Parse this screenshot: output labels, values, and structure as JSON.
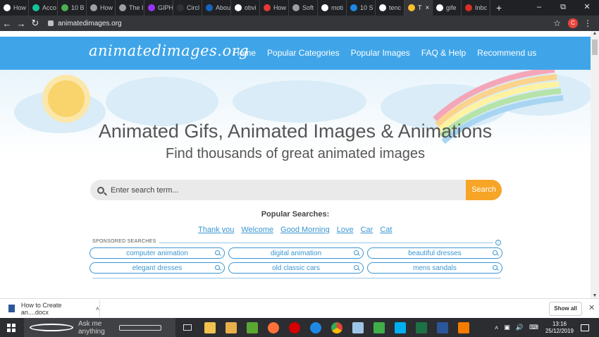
{
  "browser": {
    "tabs": [
      {
        "label": "How",
        "icon": "wikipedia-icon",
        "color": "#ffffff"
      },
      {
        "label": "Acco",
        "icon": "grammarly-icon",
        "color": "#15c39a"
      },
      {
        "label": "10 B",
        "icon": "feather-icon",
        "color": "#4caf50"
      },
      {
        "label": "How",
        "icon": "globe-icon",
        "color": "#9aa0a6"
      },
      {
        "label": "The I",
        "icon": "globe-icon",
        "color": "#9aa0a6"
      },
      {
        "label": "GIPH",
        "icon": "giphy-icon",
        "color": "#9933ff"
      },
      {
        "label": "Circl",
        "icon": "dark-icon",
        "color": "#333333"
      },
      {
        "label": "Abou",
        "icon": "gif-icon",
        "color": "#1565c0"
      },
      {
        "label": "obvi",
        "icon": "google-icon",
        "color": "#ffffff"
      },
      {
        "label": "How",
        "icon": "bookmark-icon",
        "color": "#e53935"
      },
      {
        "label": "Soft",
        "icon": "globe-icon",
        "color": "#9aa0a6"
      },
      {
        "label": "moti",
        "icon": "google-icon",
        "color": "#ffffff"
      },
      {
        "label": "10 S",
        "icon": "h-icon",
        "color": "#1e88e5"
      },
      {
        "label": "tenc",
        "icon": "google-icon",
        "color": "#ffffff"
      },
      {
        "label": "T",
        "icon": "star-icon",
        "color": "#fbc02d",
        "active": true
      },
      {
        "label": "gife",
        "icon": "google-icon",
        "color": "#ffffff"
      },
      {
        "label": "Inbc",
        "icon": "gmail-icon",
        "color": "#d93025"
      }
    ],
    "new_tab": "+",
    "url": "animatedimages.org",
    "profile_initial": "C"
  },
  "site": {
    "logo": "animatedimages.org",
    "nav": [
      "Home",
      "Popular Categories",
      "Popular Images",
      "FAQ & Help",
      "Recommend us"
    ],
    "headline": "Animated Gifs, Animated Images & Animations",
    "subheadline": "Find thousands of great animated images",
    "search": {
      "placeholder": "Enter search term...",
      "button": "Search"
    },
    "popular_title": "Popular Searches:",
    "popular_links": [
      "Thank you",
      "Welcome",
      "Good Morning",
      "Love",
      "Car",
      "Cat"
    ],
    "sponsored_label": "SPONSORED SEARCHES",
    "sponsored": [
      "computer animation",
      "digital animation",
      "beautiful dresses",
      "elegant dresses",
      "old classic cars",
      "mens sandals"
    ]
  },
  "downloads": {
    "item": "How to Create an....docx",
    "show_all": "Show all"
  },
  "taskbar": {
    "search_placeholder": "Ask me anything",
    "time": "13:16",
    "date": "25/12/2019"
  },
  "colors": {
    "header": "#3fa5e8",
    "accent": "#f7a526",
    "link": "#3a96d2"
  }
}
